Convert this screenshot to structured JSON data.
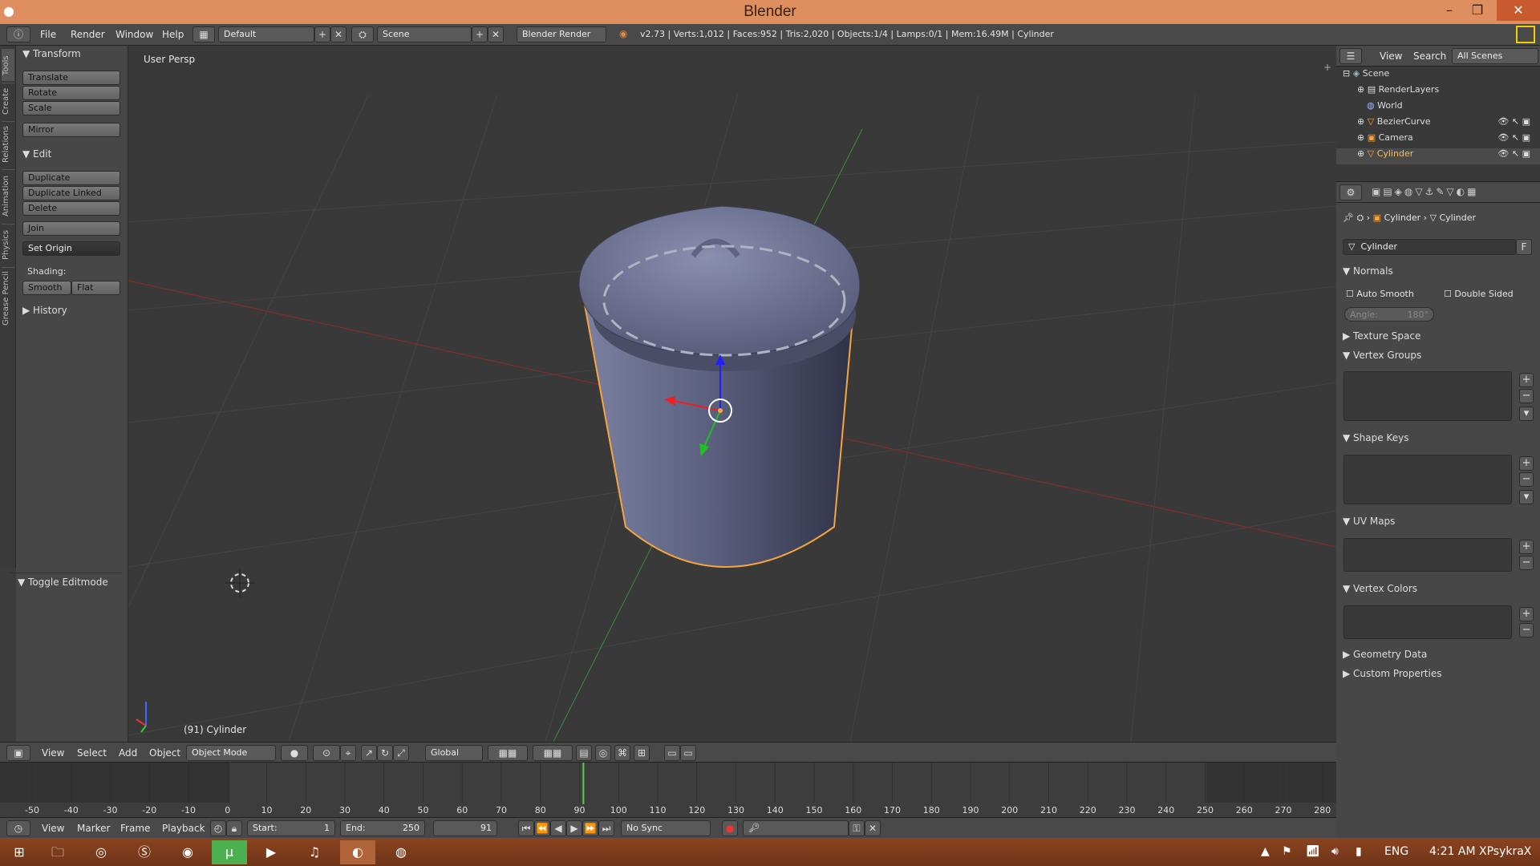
{
  "window": {
    "title": "Blender",
    "minimize": "–",
    "maximize": "❐",
    "close": "✕"
  },
  "menubar": {
    "menus": [
      "File",
      "Render",
      "Window",
      "Help"
    ],
    "layout": "Default",
    "scene": "Scene",
    "engine": "Blender Render",
    "stats": "v2.73 | Verts:1,012 | Faces:952 | Tris:2,020 | Objects:1/4 | Lamps:0/1 | Mem:16.49M | Cylinder"
  },
  "lefttabs": [
    "Tools",
    "Create",
    "Relations",
    "Animation",
    "Physics",
    "Grease Pencil"
  ],
  "toolshelf": {
    "transform_header": "Transform",
    "transform_buttons": [
      "Translate",
      "Rotate",
      "Scale"
    ],
    "mirror": "Mirror",
    "edit_header": "Edit",
    "edit_buttons": [
      "Duplicate",
      "Duplicate Linked",
      "Delete"
    ],
    "join": "Join",
    "set_origin": "Set Origin",
    "shading_label": "Shading:",
    "smooth": "Smooth",
    "flat": "Flat",
    "history_header": "History",
    "toggle_editmode": "Toggle Editmode"
  },
  "viewport": {
    "view_label": "User Persp",
    "object_label": "(91) Cylinder"
  },
  "vpheader": {
    "menus": [
      "View",
      "Select",
      "Add",
      "Object"
    ],
    "mode": "Object Mode",
    "orientation": "Global"
  },
  "timeline": {
    "ticks": [
      "-50",
      "-40",
      "-30",
      "-20",
      "-10",
      "0",
      "10",
      "20",
      "30",
      "40",
      "50",
      "60",
      "70",
      "80",
      "90",
      "100",
      "110",
      "120",
      "130",
      "140",
      "150",
      "160",
      "170",
      "180",
      "190",
      "200",
      "210",
      "220",
      "230",
      "240",
      "250",
      "260",
      "270",
      "280"
    ],
    "current_frame": 91
  },
  "tlbar": {
    "menus": [
      "View",
      "Marker",
      "Frame",
      "Playback"
    ],
    "start_label": "Start:",
    "start": "1",
    "end_label": "End:",
    "end": "250",
    "current": "91",
    "sync": "No Sync"
  },
  "outliner": {
    "menus": [
      "View",
      "Search"
    ],
    "filter": "All Scenes",
    "items": [
      "Scene",
      "RenderLayers",
      "World",
      "BezierCurve",
      "Camera",
      "Cylinder"
    ]
  },
  "props": {
    "breadcrumb_obj": "Cylinder",
    "breadcrumb_data": "Cylinder",
    "datablock": "Cylinder",
    "fake_user": "F",
    "normals": "Normals",
    "auto_smooth": "Auto Smooth",
    "double_sided": "Double Sided",
    "angle_label": "Angle:",
    "angle": "180°",
    "sections": [
      "Texture Space",
      "Vertex Groups",
      "Shape Keys",
      "UV Maps",
      "Vertex Colors",
      "Geometry Data",
      "Custom Properties"
    ]
  },
  "taskbar": {
    "lang": "ENG",
    "clock": "4:21 AM XPsykraX"
  },
  "colors": {
    "accent_orange": "#df8e5f",
    "object_outline": "#f5a540",
    "axis_red": "#c0392b",
    "axis_green": "#3aa84a",
    "frame_marker": "#52d146"
  }
}
